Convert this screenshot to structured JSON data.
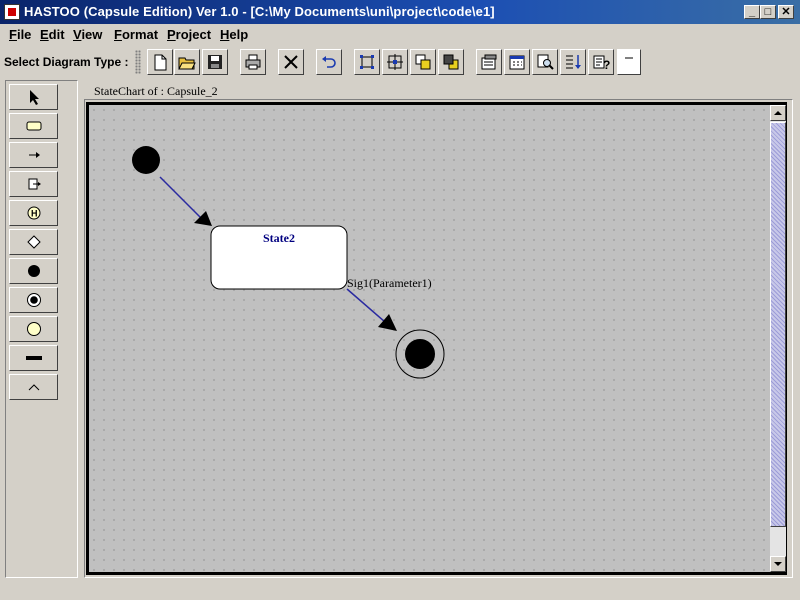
{
  "window": {
    "title": "HASTOO (Capsule Edition) Ver 1.0 - [C:\\My Documents\\uni\\project\\code\\e1]",
    "controls": [
      "minimize",
      "maximize",
      "close"
    ]
  },
  "menu": {
    "items": [
      {
        "label": "File"
      },
      {
        "label": "Edit"
      },
      {
        "label": "View"
      },
      {
        "label": "Format"
      },
      {
        "label": "Project"
      },
      {
        "label": "Help"
      }
    ]
  },
  "toolbar": {
    "diagram_type_label": "Select Diagram Type :",
    "buttons": [
      "new-file-icon",
      "open-folder-icon",
      "save-icon",
      "print-icon",
      "delete-icon",
      "undo-icon",
      "align-icon",
      "arrange-icon",
      "bring-front-icon",
      "send-back-icon",
      "properties-icon",
      "calendar-icon",
      "find-icon",
      "sort-icon",
      "help-icon",
      "minus-icon"
    ]
  },
  "palette": {
    "tools": [
      "select-arrow-icon",
      "state-tool-icon",
      "transition-tool-icon",
      "signal-tool-icon",
      "history-tool-icon",
      "choice-tool-icon",
      "initial-state-tool-icon",
      "final-state-tool-icon",
      "note-tool-icon",
      "fork-bar-tool-icon",
      "junction-tool-icon"
    ]
  },
  "canvas": {
    "label": "StateChart of : Capsule_2",
    "state": {
      "name": "State2"
    },
    "transition_label": "Sig1(Parameter1)",
    "colors": {
      "transition": "#2a2aa0",
      "state_title": "#000080"
    }
  }
}
